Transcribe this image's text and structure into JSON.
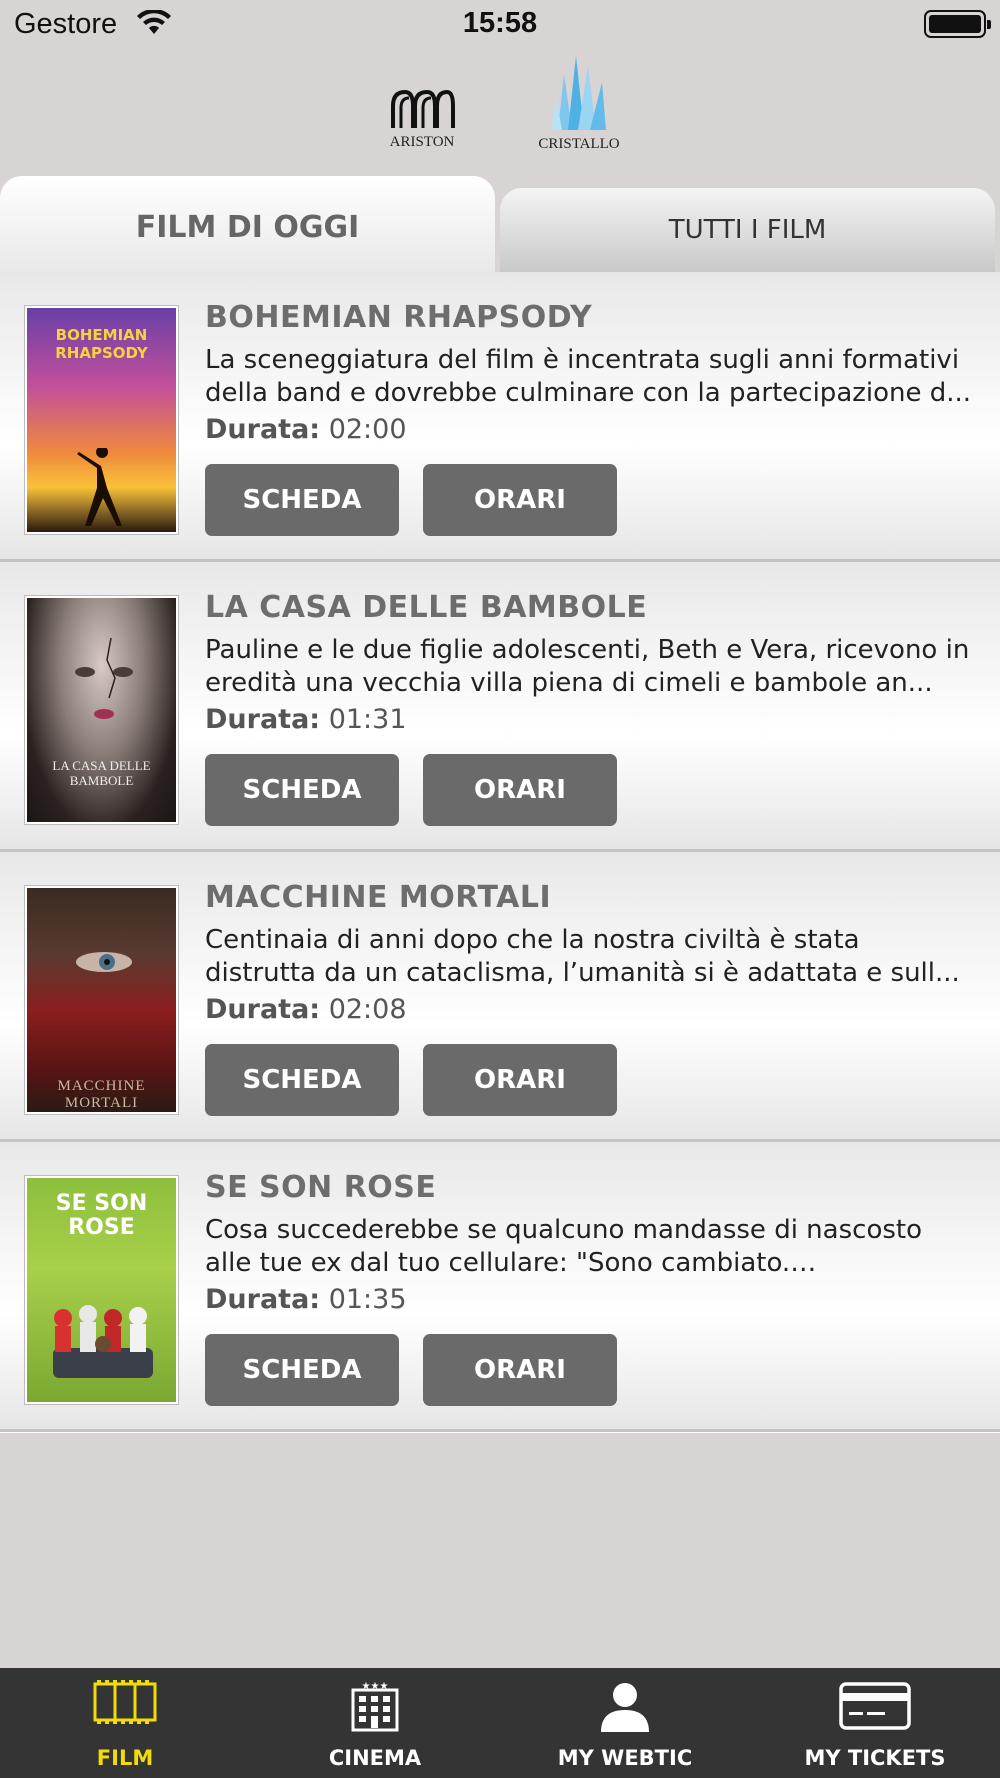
{
  "status_bar": {
    "carrier": "Gestore",
    "time": "15:58"
  },
  "logos": {
    "left": "ARISTON",
    "right": "CRISTALLO"
  },
  "tabs": [
    {
      "label": "FILM DI OGGI",
      "active": true
    },
    {
      "label": "TUTTI I FILM",
      "active": false
    }
  ],
  "movies": [
    {
      "title": "BOHEMIAN RHAPSODY",
      "synopsis": "La sceneggiatura del film è incentrata sugli anni formativi della band e dovrebbe culminare con la partecipazione d...",
      "duration_label": "Durata:",
      "duration": "02:00",
      "scheda_label": "SCHEDA",
      "orari_label": "ORARI",
      "poster_text": "BOHEMIAN RHAPSODY"
    },
    {
      "title": "LA CASA DELLE BAMBOLE",
      "synopsis": "Pauline e le due figlie adolescenti, Beth e Vera, ricevono in eredità una vecchia villa piena di cimeli e bambole an...",
      "duration_label": "Durata:",
      "duration": "01:31",
      "scheda_label": "SCHEDA",
      "orari_label": "ORARI",
      "poster_text": "LA CASA DELLE BAMBOLE"
    },
    {
      "title": "MACCHINE MORTALI",
      "synopsis": "Centinaia di anni dopo che la nostra civiltà è stata distrutta da un cataclisma, l’umanità si è adattata e sull...",
      "duration_label": "Durata:",
      "duration": "02:08",
      "scheda_label": "SCHEDA",
      "orari_label": "ORARI",
      "poster_text": "MACCHINE MORTALI"
    },
    {
      "title": "SE SON ROSE",
      "synopsis": "Cosa succederebbe se qualcuno mandasse di nascosto alle tue ex dal tuo cellulare: \"Sono cambiato. Riproviamoci!\"...",
      "duration_label": "Durata:",
      "duration": "01:35",
      "scheda_label": "SCHEDA",
      "orari_label": "ORARI",
      "poster_text": "SE SON ROSE"
    }
  ],
  "tabbar": [
    {
      "label": "FILM",
      "icon": "film-icon",
      "active": true
    },
    {
      "label": "CINEMA",
      "icon": "cinema-building-icon",
      "active": false
    },
    {
      "label": "MY WEBTIC",
      "icon": "user-icon",
      "active": false
    },
    {
      "label": "MY TICKETS",
      "icon": "card-icon",
      "active": false
    }
  ],
  "colors": {
    "active_tab": "#f1db08",
    "tabbar_bg": "#343434",
    "button_bg": "#6a6a6a"
  }
}
